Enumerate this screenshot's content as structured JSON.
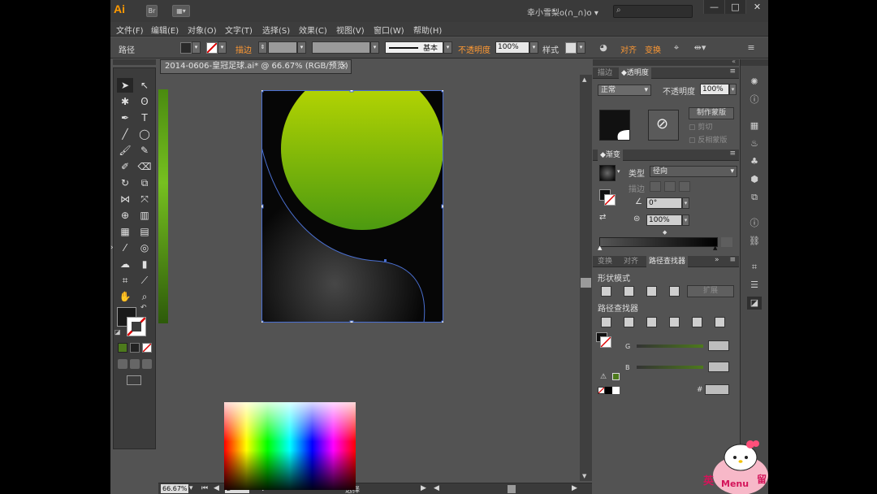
{
  "title_bar": {
    "app_logo": "Ai",
    "bridge_label": "Br",
    "user_name": "幸小雪梨o(∩_∩)o",
    "window_controls": [
      "—",
      "□",
      "✕"
    ]
  },
  "menu": [
    "文件(F)",
    "编辑(E)",
    "对象(O)",
    "文字(T)",
    "选择(S)",
    "效果(C)",
    "视图(V)",
    "窗口(W)",
    "帮助(H)"
  ],
  "control_bar": {
    "object_type": "路径",
    "stroke_label": "描边",
    "stroke_style": "基本",
    "opacity_label": "不透明度",
    "opacity_value": "100%",
    "style_label": "样式",
    "align_label": "对齐",
    "transform_label": "变换"
  },
  "document": {
    "tab_title": "2014-0606-皇冠足球.ai* @ 66.67% (RGB/预览)",
    "close_glyph": "✕"
  },
  "status_bar": {
    "zoom": "66.67%",
    "page": "2",
    "tool": "选择"
  },
  "panels": {
    "transparency": {
      "tabs": [
        "描边",
        "透明度"
      ],
      "blend_mode": "正常",
      "opacity_label": "不透明度",
      "opacity_value": "100%",
      "make_mask_button": "制作蒙版",
      "clip_label": "剪切",
      "invert_mask_label": "反相蒙版"
    },
    "gradient": {
      "tab": "渐变",
      "type_label": "类型",
      "type_value": "径向",
      "stroke_label": "描边",
      "angle_value": "0°",
      "aspect_value": "100%"
    },
    "pathfinder": {
      "tabs": [
        "变换",
        "对齐",
        "路径查找器"
      ],
      "shape_modes_label": "形状模式",
      "expand_button": "扩展",
      "pathfinders_label": "路径查找器"
    },
    "color": {
      "g_label": "G",
      "b_label": "B",
      "hex_label": "#"
    }
  },
  "colors": {
    "accent_orange": "#ff9a00",
    "lime_top": "#b9d800",
    "lime_bottom": "#4f9a12",
    "selection_blue": "#4a6fd0"
  },
  "watermark": {
    "text_left": "英",
    "text_mid": "Menu",
    "text_right": "留"
  }
}
